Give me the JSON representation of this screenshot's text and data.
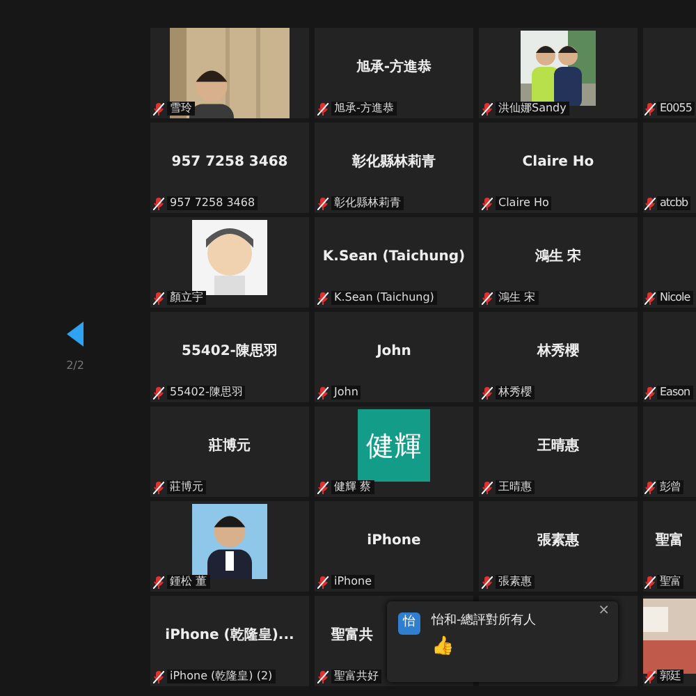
{
  "pager": {
    "label": "2/2"
  },
  "tiles": [
    {
      "kind": "video",
      "label": "雪玲"
    },
    {
      "kind": "name",
      "name": "旭承-方進恭",
      "label": "旭承-方進恭"
    },
    {
      "label": "洪仙娜Sandy"
    },
    {
      "kind": "blank",
      "label": "E0055"
    },
    {
      "kind": "name",
      "name": "957 7258 3468",
      "label": "957 7258 3468"
    },
    {
      "kind": "name",
      "name": "彰化縣林莉青",
      "label": "彰化縣林莉青"
    },
    {
      "kind": "name",
      "name": "Claire Ho",
      "label": "Claire Ho"
    },
    {
      "kind": "blank",
      "label": "atcbb"
    },
    {
      "kind": "avatar",
      "label": "顏立宇"
    },
    {
      "kind": "name",
      "name": "K.Sean (Taichung)",
      "label": "K.Sean (Taichung)"
    },
    {
      "kind": "name",
      "name": "鴻生 宋",
      "label": "鴻生 宋"
    },
    {
      "kind": "blank",
      "label": "Nicole"
    },
    {
      "kind": "name",
      "name": "55402-陳思羽",
      "label": "55402-陳思羽"
    },
    {
      "kind": "name",
      "name": "John",
      "label": "John"
    },
    {
      "kind": "name",
      "name": "林秀櫻",
      "label": "林秀櫻"
    },
    {
      "kind": "blank",
      "label": "Eason"
    },
    {
      "kind": "name",
      "name": "莊博元",
      "label": "莊博元"
    },
    {
      "kind": "initials",
      "name": "健輝",
      "label": "健輝 蔡"
    },
    {
      "kind": "name",
      "name": "王晴惠",
      "label": "王晴惠"
    },
    {
      "kind": "blank",
      "label": "彭曾"
    },
    {
      "label": "鍾松 董"
    },
    {
      "kind": "name",
      "name": "iPhone",
      "label": "iPhone"
    },
    {
      "kind": "name",
      "name": "張素惠",
      "label": "張素惠"
    },
    {
      "kind": "name",
      "name": "聖富",
      "label": "聖富"
    },
    {
      "kind": "name",
      "name": "iPhone (乾隆皇)...",
      "label": "iPhone (乾隆皇) (2)"
    },
    {
      "kind": "name",
      "name": "聖富共",
      "label": "聖富共好"
    },
    {
      "kind": "blank"
    },
    {
      "label": "郭廷"
    }
  ],
  "notification": {
    "avatar": "怡",
    "title": "怡和-總評對所有人",
    "message": "👍",
    "close": "×"
  }
}
